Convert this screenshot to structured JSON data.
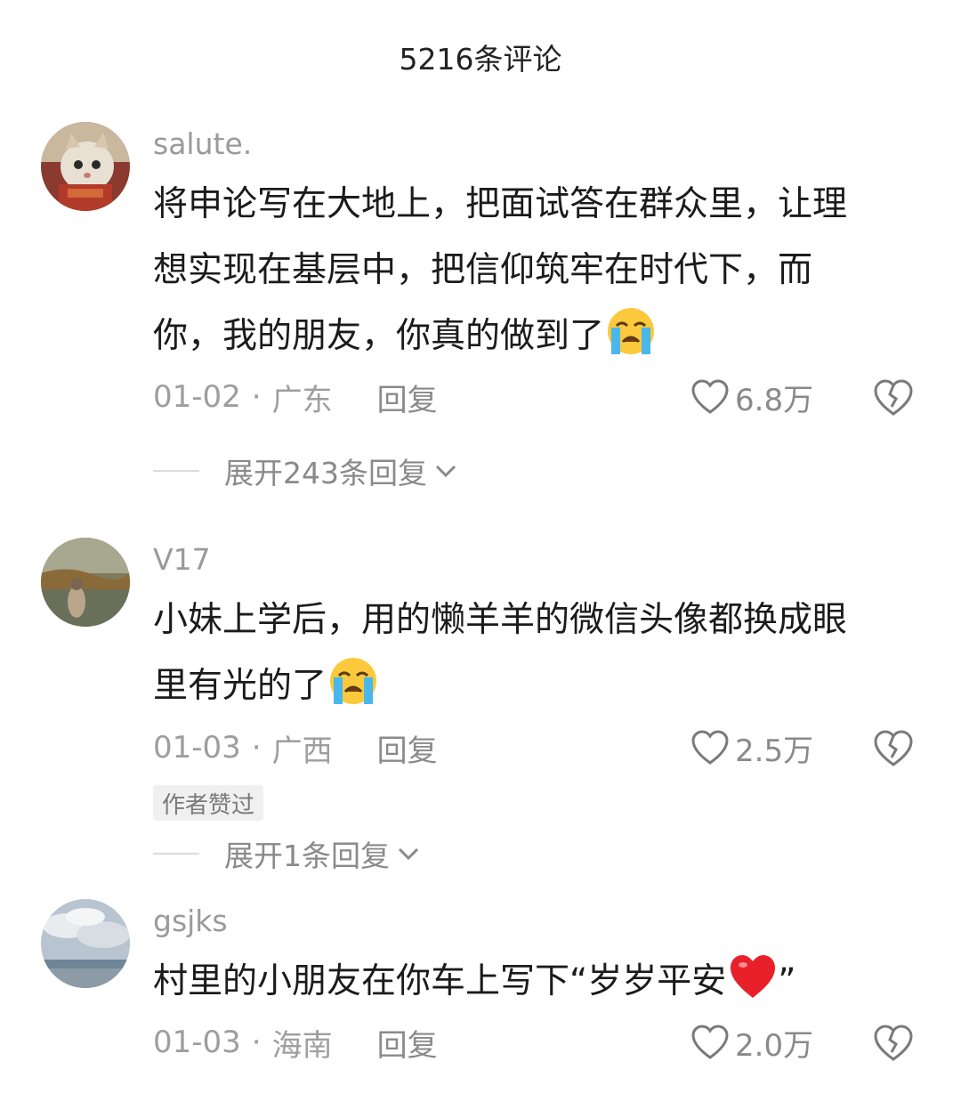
{
  "header": {
    "title": "5216条评论"
  },
  "comments": [
    {
      "username": "salute.",
      "lines": [
        "将申论写在大地上，把面试答在群众里，让理",
        "想实现在基层中，把信仰筑牢在时代下，而",
        "你，我的朋友，你真的做到了"
      ],
      "emoji": "loudly-crying-face",
      "date": "01-02",
      "sep": "·",
      "location": "广东",
      "reply_label": "回复",
      "likes": "6.8万",
      "expand_label": "展开243条回复"
    },
    {
      "username": "V17",
      "lines": [
        "小妹上学后，用的懒羊羊的微信头像都换成眼",
        "里有光的了"
      ],
      "emoji": "loudly-crying-face",
      "date": "01-03",
      "sep": "·",
      "location": "广西",
      "reply_label": "回复",
      "likes": "2.5万",
      "badge": "作者赞过",
      "expand_label": "展开1条回复"
    },
    {
      "username": "gsjks",
      "lines": [
        "村里的小朋友在你车上写下“岁岁平安",
        "”"
      ],
      "emoji": "red-heart",
      "date": "01-03",
      "sep": "·",
      "location": "海南",
      "reply_label": "回复",
      "likes": "2.0万"
    }
  ]
}
